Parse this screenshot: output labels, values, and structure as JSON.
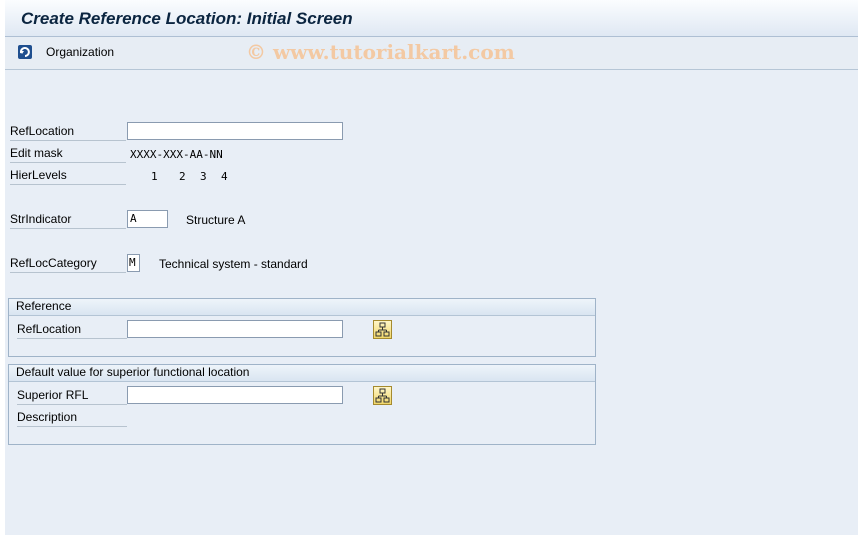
{
  "window": {
    "title": "Create Reference Location: Initial Screen"
  },
  "toolbar": {
    "organization_label": "Organization",
    "organization_icon": "organization-icon"
  },
  "watermark": "© www.tutorialkart.com",
  "form": {
    "refloc_label": "RefLocation",
    "refloc_value": "",
    "editmask_label": "Edit mask",
    "editmask_value": "XXXX-XXX-AA-NN",
    "hierlevels_label": "HierLevels",
    "hierlevels": [
      "1",
      "2",
      "3",
      "4"
    ],
    "strindicator_label": "StrIndicator",
    "strindicator_value": "A",
    "strindicator_text": "Structure A",
    "reflocct_label": "RefLocCategory",
    "reflocct_value": "M",
    "reflocct_text": "Technical system - standard"
  },
  "reference": {
    "title": "Reference",
    "refloc_label": "RefLocation",
    "refloc_value": ""
  },
  "superior": {
    "title": "Default value for superior functional location",
    "rfl_label": "Superior RFL",
    "rfl_value": "",
    "description_label": "Description"
  }
}
